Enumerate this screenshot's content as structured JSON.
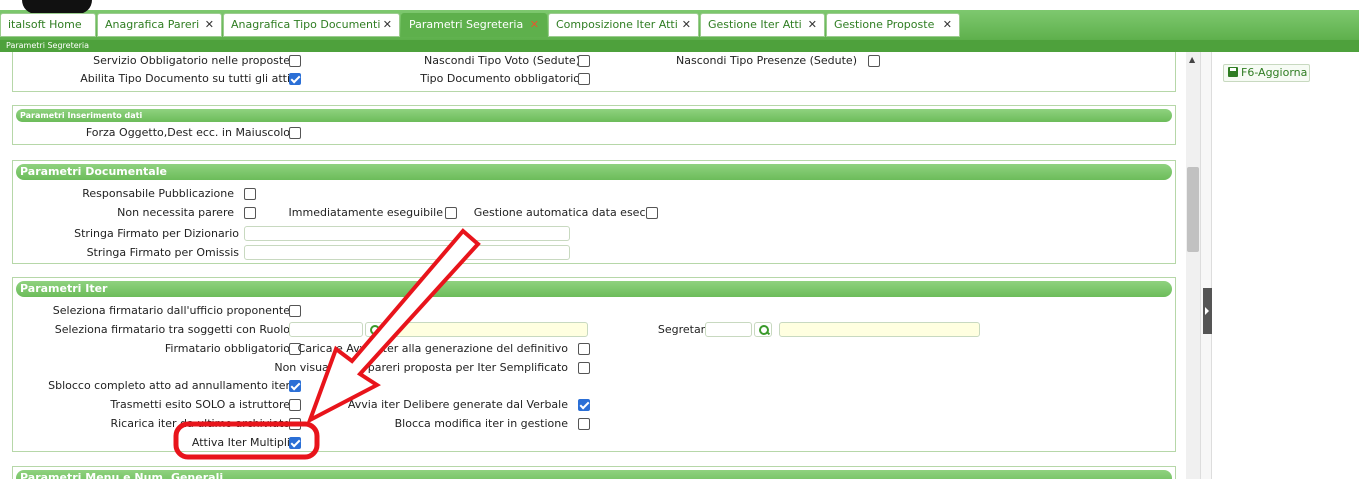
{
  "tabs": [
    {
      "label": "italsoft Home",
      "closable": false,
      "active": false
    },
    {
      "label": "Anagrafica Pareri",
      "closable": true,
      "active": false
    },
    {
      "label": "Anagrafica Tipo Documenti",
      "closable": true,
      "active": false
    },
    {
      "label": "Parametri Segreteria",
      "closable": true,
      "active": true
    },
    {
      "label": "Composizione Iter Atti",
      "closable": true,
      "active": false
    },
    {
      "label": "Gestione Iter Atti",
      "closable": true,
      "active": false
    },
    {
      "label": "Gestione Proposte",
      "closable": true,
      "active": false
    }
  ],
  "close_glyph": "✕",
  "breadcrumb": "Parametri Segreteria",
  "top_section": {
    "rows": [
      {
        "label": "Servizio Obbligatorio nelle proposte",
        "checked": false
      },
      {
        "label": "Nascondi Tipo Voto (Sedute)",
        "checked": false
      },
      {
        "label": "Nascondi Tipo Presenze (Sedute)",
        "checked": false
      },
      {
        "label": "Abilita Tipo Documento su tutti gli atti",
        "checked": true
      },
      {
        "label": "Tipo Documento obbligatorio",
        "checked": false
      }
    ]
  },
  "inserimento": {
    "title": "Parametri Inserimento dati",
    "rows": [
      {
        "label": "Forza Oggetto,Dest ecc. in Maiuscolo",
        "checked": false
      }
    ]
  },
  "documentale": {
    "title": "Parametri Documentale",
    "rows": [
      {
        "label": "Responsabile Pubblicazione",
        "checked": false
      },
      {
        "label": "Non necessita parere",
        "checked": false
      },
      {
        "label": "Immediatamente eseguibile",
        "checked": false
      },
      {
        "label": "Gestione automatica data esec.",
        "checked": false
      }
    ],
    "fields": [
      {
        "label": "Stringa Firmato per Dizionario",
        "value": ""
      },
      {
        "label": "Stringa Firmato per Omissis",
        "value": ""
      }
    ]
  },
  "iter": {
    "title": "Parametri Iter",
    "rows": [
      {
        "label": "Seleziona firmatario dall'ufficio proponente",
        "checked": false
      },
      {
        "label": "Seleziona firmatario tra soggetti con Ruolo",
        "checked": false
      },
      {
        "label": "Segretario",
        "checked": false
      },
      {
        "label": "Firmatario obbligatorio",
        "checked": false
      },
      {
        "label": "Carica e Avvia Iter alla generazione del definitivo",
        "checked": false
      },
      {
        "label": "Non visualizzare pareri proposta per Iter Semplificato",
        "checked": false
      },
      {
        "label": "Sblocco completo atto ad annullamento iter",
        "checked": true
      },
      {
        "label": "Trasmetti esito SOLO a istruttore",
        "checked": false
      },
      {
        "label": "Avvia iter Delibere generate dal Verbale",
        "checked": true
      },
      {
        "label": "Ricarica iter da ultimo archiviato",
        "checked": false
      },
      {
        "label": "Blocca modifica iter in gestione",
        "checked": false
      },
      {
        "label": "Attiva Iter Multipli",
        "checked": true
      }
    ]
  },
  "next_section": {
    "title": "Parametri Menu e Num. Generali"
  },
  "sidebar": {
    "save_label": "F6-Aggiorna"
  },
  "annotation": {
    "color": "#e8141b",
    "highlight": "Attiva Iter Multipli"
  }
}
